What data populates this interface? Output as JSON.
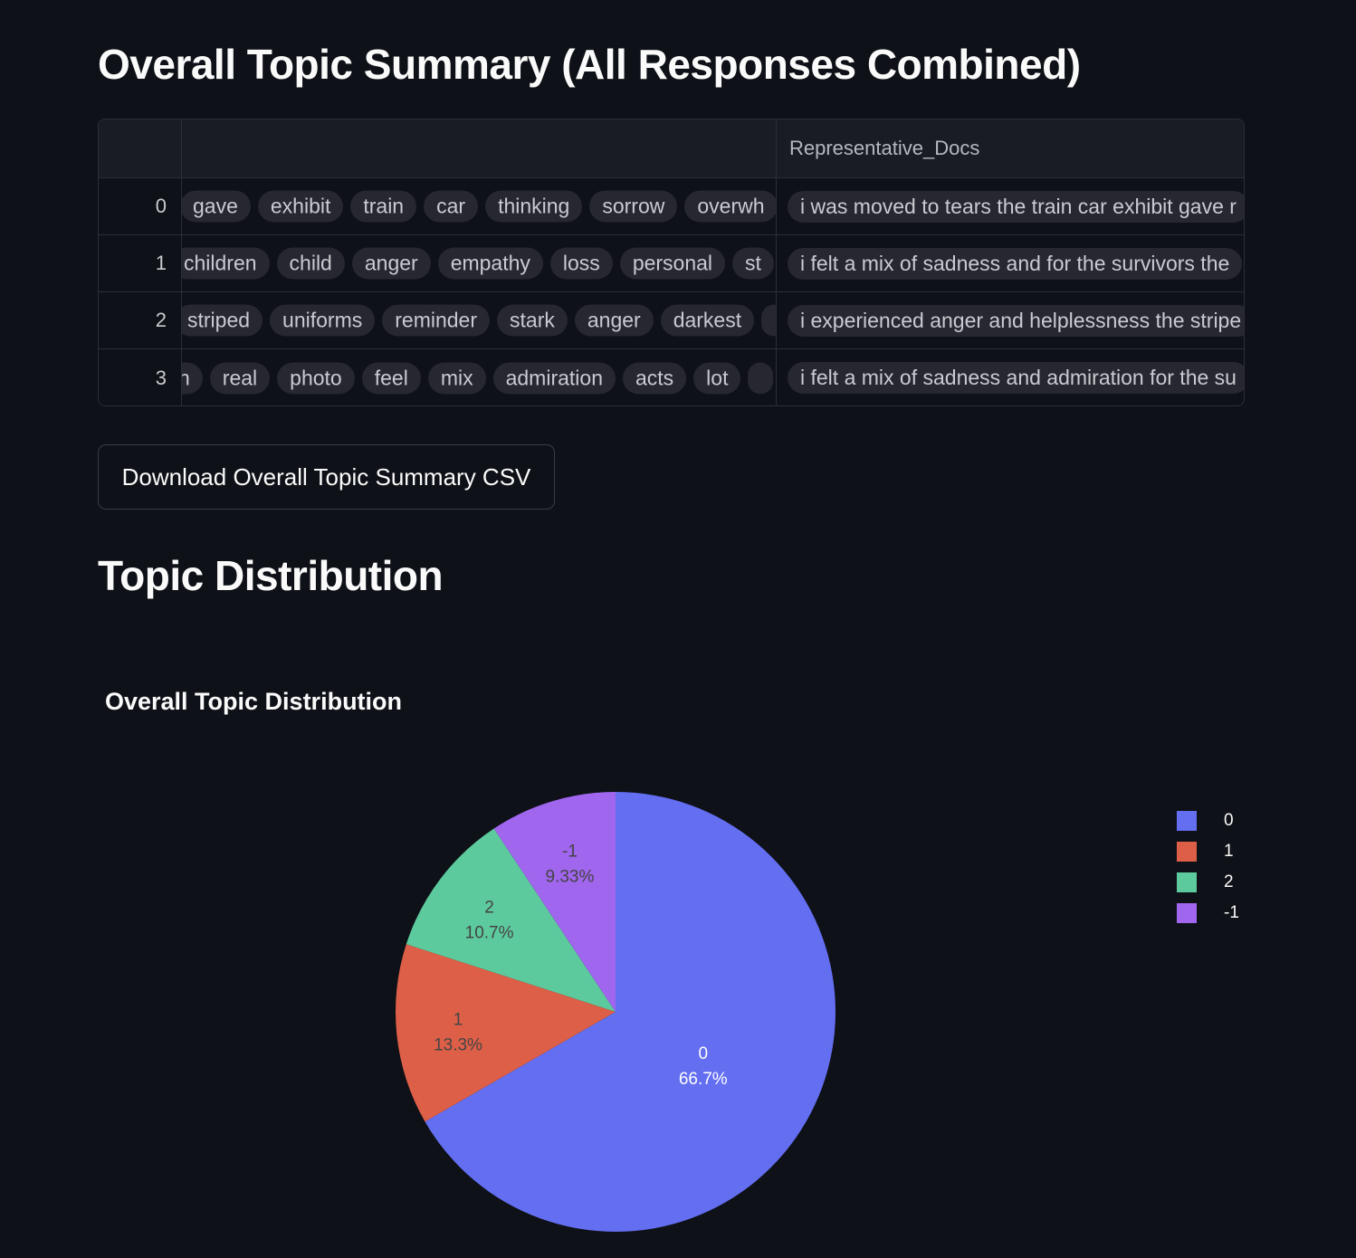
{
  "summary": {
    "title": "Overall Topic Summary (All Responses Combined)",
    "table": {
      "columns": [
        "",
        "",
        "Representative_Docs"
      ],
      "rows": [
        {
          "index": "0",
          "keywords": [
            "gave",
            "exhibit",
            "train",
            "car",
            "thinking",
            "sorrow",
            "overwh"
          ],
          "doc": "i was moved to tears the train car exhibit gave r"
        },
        {
          "index": "1",
          "keywords": [
            "children",
            "child",
            "anger",
            "empathy",
            "loss",
            "personal",
            "st"
          ],
          "doc": "i felt a mix of sadness and for the survivors the"
        },
        {
          "index": "2",
          "keywords": [
            "striped",
            "uniforms",
            "reminder",
            "stark",
            "anger",
            "darkest",
            ""
          ],
          "doc": "i experienced anger and helplessness the stripe"
        },
        {
          "index": "3",
          "keywords": [
            "n",
            "real",
            "photo",
            "feel",
            "mix",
            "admiration",
            "acts",
            "lot",
            ""
          ],
          "doc": "i felt a mix of sadness and admiration for the su"
        }
      ]
    },
    "download_label": "Download Overall Topic Summary CSV"
  },
  "distribution": {
    "title": "Topic Distribution"
  },
  "chart_data": {
    "type": "pie",
    "title": "Overall Topic Distribution",
    "labels": [
      "0",
      "1",
      "2",
      "-1"
    ],
    "values": [
      66.7,
      13.3,
      10.7,
      9.33
    ],
    "percent_labels": [
      "66.7%",
      "13.3%",
      "10.7%",
      "9.33%"
    ],
    "colors": [
      "#636efa",
      "#ef553b",
      "#00cc96",
      "#ab63fa"
    ],
    "slice_colors_rendered": [
      "#636ef0",
      "#dd5f48",
      "#5dca9d",
      "#a066ee"
    ],
    "legend": [
      "0",
      "1",
      "2",
      "-1"
    ],
    "legend_position": "top-right",
    "text_colors": [
      "#ffffff",
      "#444444",
      "#444444",
      "#444444"
    ]
  }
}
